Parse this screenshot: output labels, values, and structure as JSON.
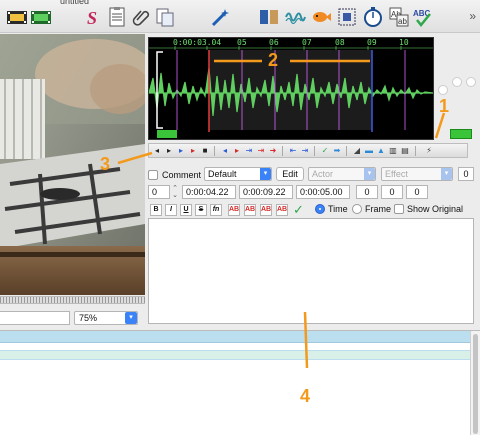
{
  "window": {
    "title": "untitled"
  },
  "toolbar": {
    "icons": [
      "film-strip-icon",
      "film-strip-green-icon",
      "styles-s-icon",
      "script-notes-icon",
      "paperclip-icon",
      "copy-pages-icon",
      "magic-wand-icon",
      "split-windows-icon",
      "waveform-icon",
      "fish-icon",
      "select-frame-icon",
      "stopwatch-icon",
      "translate-ab-icon",
      "spell-check-icon"
    ],
    "overflow_label": "»"
  },
  "video": {
    "zoom_value": "75%",
    "seek_accent": "#2a2a2a"
  },
  "audio": {
    "time_ticks": [
      "0:00:03.04",
      "05",
      "06",
      "07",
      "08",
      "09",
      "10"
    ],
    "waveform_color": "#5fcf5f",
    "selection_color": "#8a2be2",
    "keyframe_color": "#d966ff"
  },
  "audio_toolbar": {
    "buttons": [
      "play-prev-icon",
      "play-next-icon",
      "play-selection-icon",
      "play-line-icon",
      "stop-icon",
      "play-before-icon",
      "play-after-icon",
      "play-start-icon",
      "play-end-icon",
      "play-to-end-icon",
      "zoom-in-icon",
      "zoom-out-icon",
      "commit-icon",
      "goto-icon",
      "spectrum-icon",
      "snap-icon",
      "karaoke-icon",
      "auto-scroll-icon",
      "spectrum-mode-icon",
      "wand-icon"
    ]
  },
  "edit": {
    "comment_label": "Comment",
    "style_value": "Default",
    "edit_label": "Edit",
    "actor_placeholder": "Actor",
    "effect_placeholder": "Effect",
    "line_count": "0",
    "layer_value": "0",
    "start_time": "0:00:04.22",
    "end_time": "0:00:09.22",
    "duration": "0:00:05.00",
    "margin_l": "0",
    "margin_r": "0",
    "margin_v": "0",
    "format_buttons": [
      "B",
      "I",
      "U",
      "S",
      "fn",
      "AB",
      "AB",
      "AB",
      "AB"
    ],
    "time_label": "Time",
    "frame_label": "Frame",
    "show_original_label": "Show Original"
  },
  "callouts": {
    "c1": "1",
    "c2": "2",
    "c3": "3",
    "c4": "4",
    "color": "#f39a1d"
  }
}
